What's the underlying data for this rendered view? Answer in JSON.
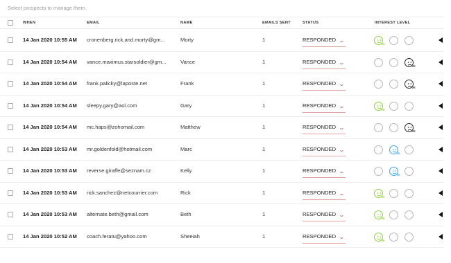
{
  "hint": "Select prospects to manage them.",
  "columns": {
    "when": "WHEN",
    "email": "EMAIL",
    "name": "NAME",
    "emails_sent": "EMAILS SENT",
    "status": "STATUS",
    "interest": "INTEREST LEVEL"
  },
  "ai_label": "AI",
  "colors": {
    "positive": "#8ccf3c",
    "neutral": "#3aa3dd",
    "negative": "#222222",
    "status_underline": "#e3a1a1"
  },
  "rows": [
    {
      "when": "14 Jan 2020 10:55 AM",
      "email": "cronenberg.rick.and.morty@gm...",
      "name": "Morty",
      "sent": "1",
      "status": "RESPONDED",
      "interest": "positive"
    },
    {
      "when": "14 Jan 2020 10:54 AM",
      "email": "vance.maximus.starsoldier@gm...",
      "name": "Vance",
      "sent": "1",
      "status": "RESPONDED",
      "interest": "negative"
    },
    {
      "when": "14 Jan 2020 10:54 AM",
      "email": "frank.palicky@laposte.net",
      "name": "Frank",
      "sent": "1",
      "status": "RESPONDED",
      "interest": "negative"
    },
    {
      "when": "14 Jan 2020 10:54 AM",
      "email": "sleepy.gary@aol.com",
      "name": "Gary",
      "sent": "1",
      "status": "RESPONDED",
      "interest": "positive"
    },
    {
      "when": "14 Jan 2020 10:54 AM",
      "email": "mc.haps@zohomail.com",
      "name": "Matthew",
      "sent": "1",
      "status": "RESPONDED",
      "interest": "negative"
    },
    {
      "when": "14 Jan 2020 10:53 AM",
      "email": "mr.goldenfold@hotmail.com",
      "name": "Marc",
      "sent": "1",
      "status": "RESPONDED",
      "interest": "neutral"
    },
    {
      "when": "14 Jan 2020 10:53 AM",
      "email": "reverse.giraffe@seznam.cz",
      "name": "Kelly",
      "sent": "1",
      "status": "RESPONDED",
      "interest": "neutral"
    },
    {
      "when": "14 Jan 2020 10:53 AM",
      "email": "rick.sanchez@netcourrier.com",
      "name": "Rick",
      "sent": "1",
      "status": "RESPONDED",
      "interest": "positive"
    },
    {
      "when": "14 Jan 2020 10:53 AM",
      "email": "alternate.beth@gmail.com",
      "name": "Beth",
      "sent": "1",
      "status": "RESPONDED",
      "interest": "positive"
    },
    {
      "when": "14 Jan 2020 10:52 AM",
      "email": "coach.feratu@yahoo.com",
      "name": "Sheeiah",
      "sent": "1",
      "status": "RESPONDED",
      "interest": "positive"
    }
  ]
}
